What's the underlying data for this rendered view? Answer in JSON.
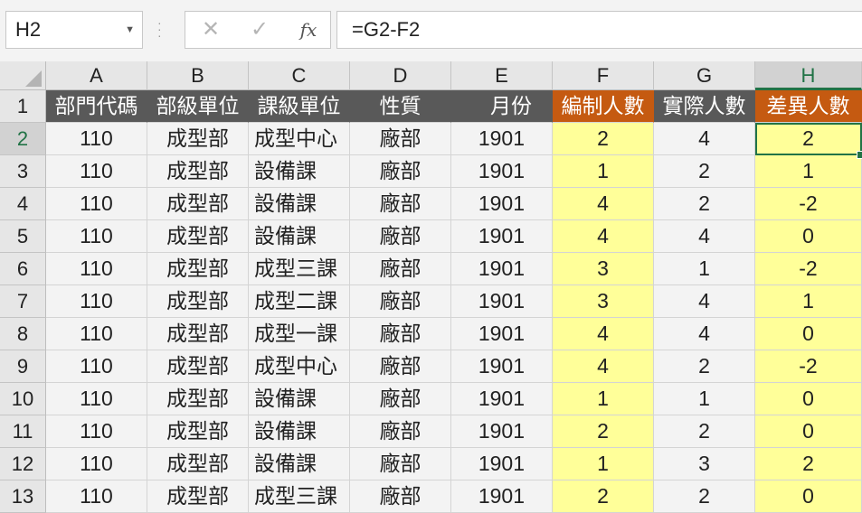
{
  "name_box": "H2",
  "formula_bar": "=G2-F2",
  "formula_buttons": {
    "cancel": "✕",
    "enter": "✓",
    "function": "fx"
  },
  "columns": [
    "A",
    "B",
    "C",
    "D",
    "E",
    "F",
    "G",
    "H"
  ],
  "selected_cell": "H2",
  "header_row": [
    "部門代碼",
    "部級單位",
    "課級單位",
    "性質",
    "月份",
    "編制人數",
    "實際人數",
    "差異人數"
  ],
  "rows": [
    {
      "n": "2",
      "cells": [
        "110",
        "成型部",
        "成型中心",
        "廠部",
        "1901",
        "2",
        "4",
        "2"
      ]
    },
    {
      "n": "3",
      "cells": [
        "110",
        "成型部",
        "設備課",
        "廠部",
        "1901",
        "1",
        "2",
        "1"
      ]
    },
    {
      "n": "4",
      "cells": [
        "110",
        "成型部",
        "設備課",
        "廠部",
        "1901",
        "4",
        "2",
        "-2"
      ]
    },
    {
      "n": "5",
      "cells": [
        "110",
        "成型部",
        "設備課",
        "廠部",
        "1901",
        "4",
        "4",
        "0"
      ]
    },
    {
      "n": "6",
      "cells": [
        "110",
        "成型部",
        "成型三課",
        "廠部",
        "1901",
        "3",
        "1",
        "-2"
      ]
    },
    {
      "n": "7",
      "cells": [
        "110",
        "成型部",
        "成型二課",
        "廠部",
        "1901",
        "3",
        "4",
        "1"
      ]
    },
    {
      "n": "8",
      "cells": [
        "110",
        "成型部",
        "成型一課",
        "廠部",
        "1901",
        "4",
        "4",
        "0"
      ]
    },
    {
      "n": "9",
      "cells": [
        "110",
        "成型部",
        "成型中心",
        "廠部",
        "1901",
        "4",
        "2",
        "-2"
      ]
    },
    {
      "n": "10",
      "cells": [
        "110",
        "成型部",
        "設備課",
        "廠部",
        "1901",
        "1",
        "1",
        "0"
      ]
    },
    {
      "n": "11",
      "cells": [
        "110",
        "成型部",
        "設備課",
        "廠部",
        "1901",
        "2",
        "2",
        "0"
      ]
    },
    {
      "n": "12",
      "cells": [
        "110",
        "成型部",
        "設備課",
        "廠部",
        "1901",
        "1",
        "3",
        "2"
      ]
    },
    {
      "n": "13",
      "cells": [
        "110",
        "成型部",
        "成型三課",
        "廠部",
        "1901",
        "2",
        "2",
        "0"
      ]
    }
  ],
  "header_row_number": "1",
  "colors": {
    "dark_header": "#595959",
    "orange_header": "#c55a11",
    "highlight": "#ffff99",
    "accent": "#217346"
  }
}
